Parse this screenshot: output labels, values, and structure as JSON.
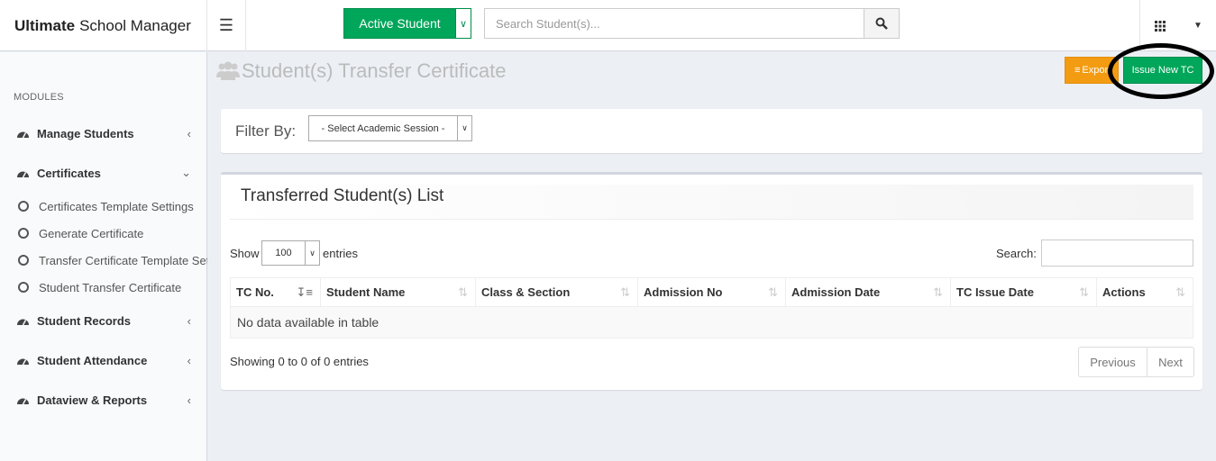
{
  "app": {
    "title_bold": "Ultimate",
    "title_rest": "School Manager"
  },
  "header": {
    "toggle_icon": "hamburger-icon",
    "active_student_label": "Active Student",
    "search_placeholder": "Search Student(s)...",
    "search_icon": "search-icon",
    "apps_icon": "grid-icon"
  },
  "sidebar": {
    "section_label": "MODULES",
    "items": [
      {
        "label": "Manage Students",
        "icon": "dashboard-icon",
        "expanded": false
      },
      {
        "label": "Certificates",
        "icon": "dashboard-icon",
        "expanded": true
      },
      {
        "label": "Student Records",
        "icon": "dashboard-icon",
        "expanded": false
      },
      {
        "label": "Student Attendance",
        "icon": "dashboard-icon",
        "expanded": false
      },
      {
        "label": "Dataview & Reports",
        "icon": "dashboard-icon",
        "expanded": false
      }
    ],
    "sub_items": [
      {
        "label": "Certificates Template Settings"
      },
      {
        "label": "Generate Certificate"
      },
      {
        "label": "Transfer Certificate Template Settings"
      },
      {
        "label": "Student Transfer Certificate"
      }
    ]
  },
  "main": {
    "page_title": "Student(s) Transfer Certificate",
    "export_label": "Export",
    "issue_label": "Issue New TC",
    "filter": {
      "label": "Filter By:",
      "session_value": "- Select Academic Session -"
    },
    "list": {
      "title": "Transferred Student(s) List",
      "show_label": "Show",
      "length_value": "100",
      "entries_label": "entries",
      "search_label": "Search:",
      "columns": [
        "TC No.",
        "Student Name",
        "Class & Section",
        "Admission No",
        "Admission Date",
        "TC Issue Date",
        "Actions"
      ],
      "empty_text": "No data available in table",
      "info_text": "Showing 0 to 0 of 0 entries",
      "prev_label": "Previous",
      "next_label": "Next"
    }
  },
  "colors": {
    "green": "#00a65a",
    "orange": "#f39c12",
    "background": "#ecf0f5"
  }
}
